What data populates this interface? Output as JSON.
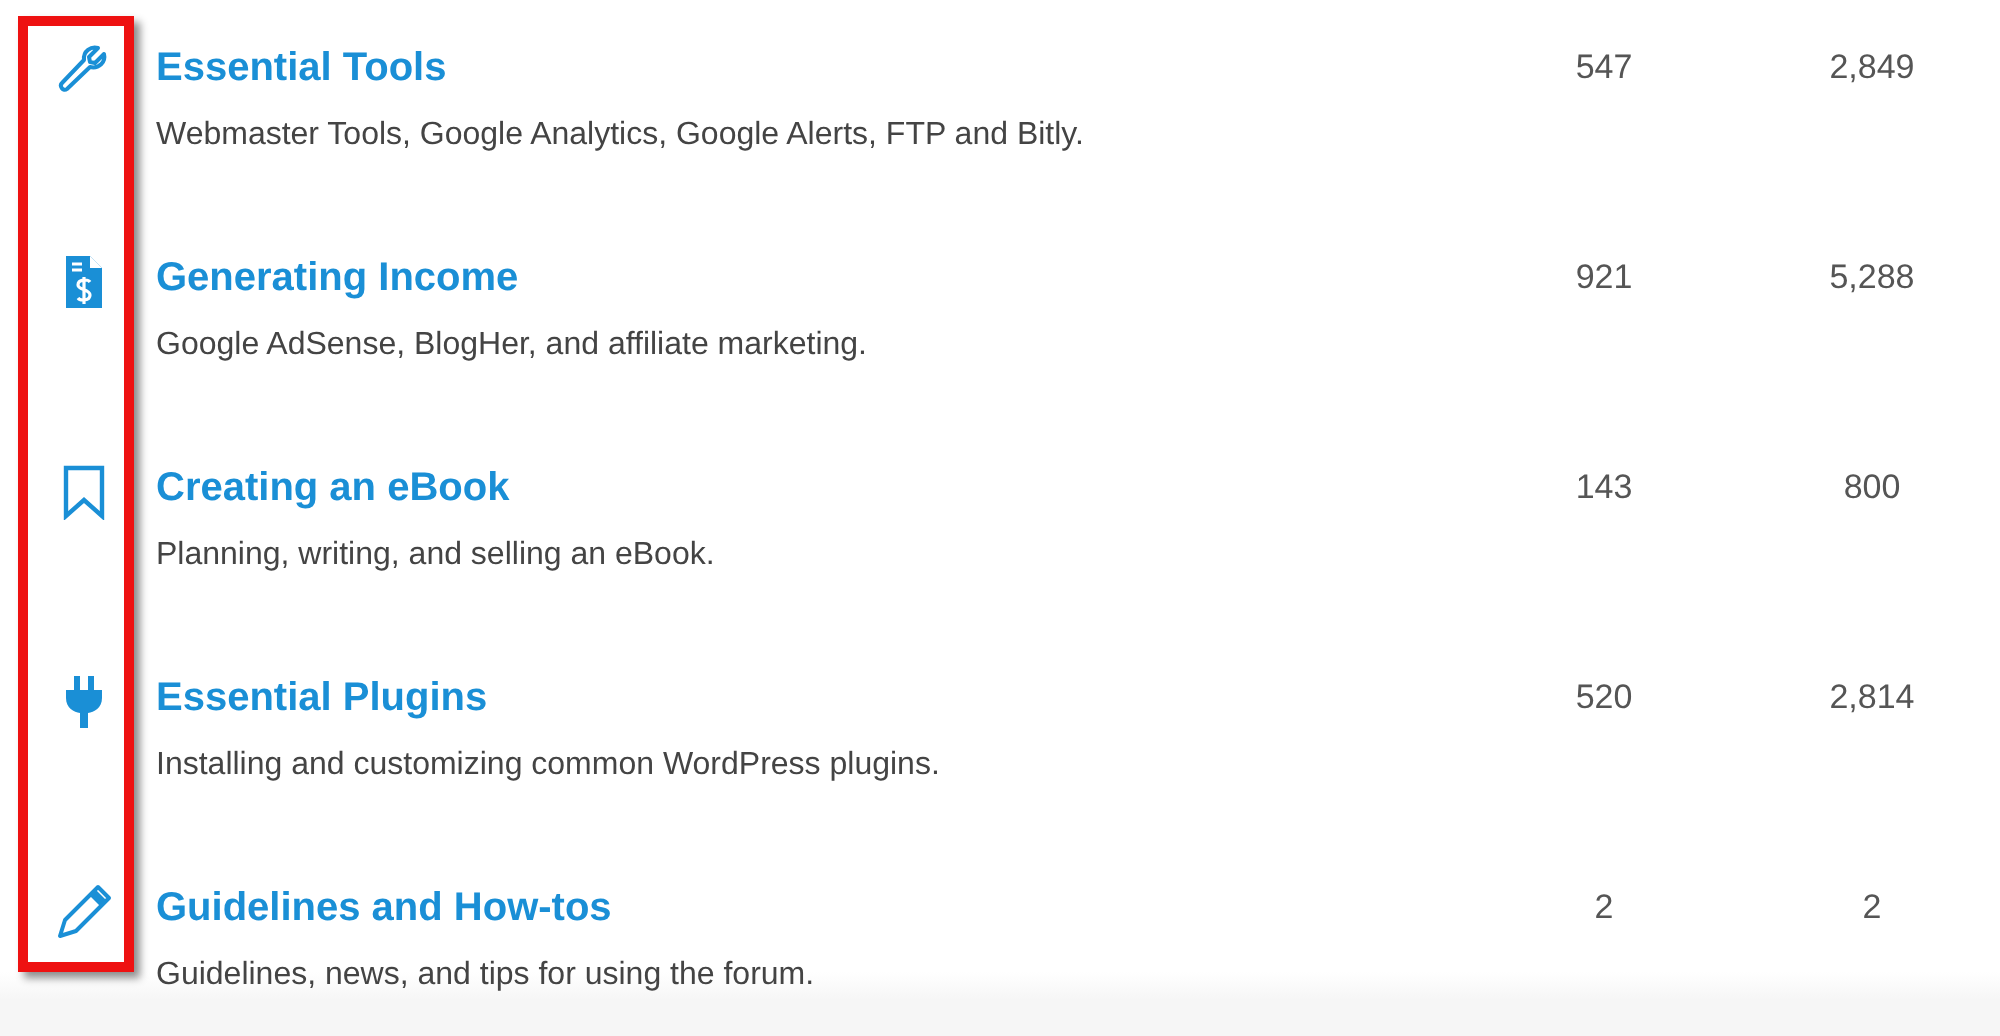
{
  "forums": [
    {
      "kind": "wrench",
      "title": "Essential Tools",
      "description": "Webmaster Tools, Google Analytics, Google Alerts, FTP and Bitly.",
      "topics": "547",
      "posts": "2,849"
    },
    {
      "kind": "invoice",
      "title": "Generating Income",
      "description": "Google AdSense, BlogHer, and affiliate marketing.",
      "topics": "921",
      "posts": "5,288"
    },
    {
      "kind": "bookmark",
      "title": "Creating an eBook",
      "description": "Planning, writing, and selling an eBook.",
      "topics": "143",
      "posts": "800"
    },
    {
      "kind": "plug",
      "title": "Essential Plugins",
      "description": "Installing and customizing common WordPress plugins.",
      "topics": "520",
      "posts": "2,814"
    },
    {
      "kind": "pencil",
      "title": "Guidelines and How-tos",
      "description": "Guidelines, news, and tips for using the forum.",
      "topics": "2",
      "posts": "2"
    }
  ]
}
